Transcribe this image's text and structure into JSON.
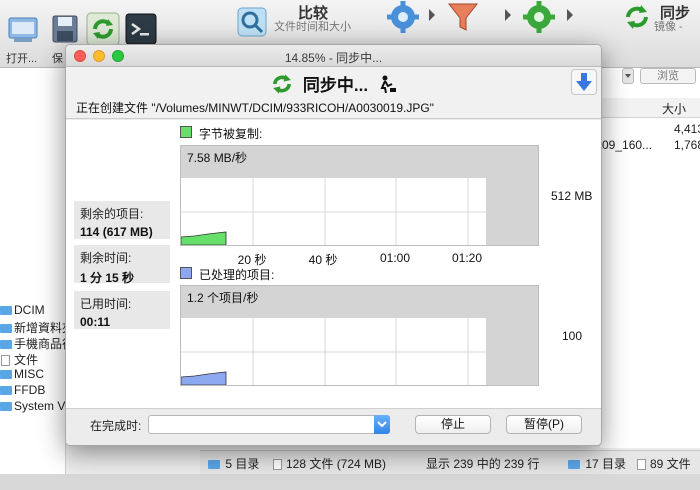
{
  "background": {
    "toolbar": {
      "open_label": "打开...",
      "save_label": "保",
      "compare_label": "比较",
      "compare_sub": "文件时间和大小",
      "sync_label": "同步",
      "sync_sub": "镜像 -"
    },
    "right_panel": {
      "browse_label": "浏览",
      "size_header": "大小",
      "size_1": "4,413",
      "name_2": "09_160...",
      "size_2": "1,768"
    },
    "tree": [
      {
        "label": "DCIM",
        "type": "folder"
      },
      {
        "label": "新增資料夾",
        "type": "folder"
      },
      {
        "label": "手機商品行",
        "type": "folder"
      },
      {
        "label": "文件",
        "type": "doc"
      },
      {
        "label": "MISC",
        "type": "folder"
      },
      {
        "label": "FFDB",
        "type": "folder"
      },
      {
        "label": "System V",
        "type": "folder"
      }
    ],
    "status": {
      "dirs_left": "5 目录",
      "files_left": "128 文件 (724 MB)",
      "shown": "显示 239 中的 239 行",
      "dirs_right": "17 目录",
      "files_right": "89 文件"
    }
  },
  "dialog": {
    "window_title": "14.85% - 同步中...",
    "heading": "同步中...",
    "creating_text": "正在创建文件 \"/Volumes/MINWT/DCIM/933RICOH/A0030019.JPG\"",
    "stats": {
      "remaining_items_label": "剩余的项目:",
      "remaining_items_value": "114 (617 MB)",
      "remaining_time_label": "剩余时间:",
      "remaining_time_value": "1 分 15 秒",
      "elapsed_time_label": "已用时间:",
      "elapsed_time_value": "00:11"
    },
    "on_complete_label": "在完成时:",
    "on_complete_value": "",
    "stop_label": "停止",
    "pause_label": "暂停(P)"
  },
  "colors": {
    "bytes_green": "#66e06a",
    "items_blue": "#8ca8f0",
    "accent_blue": "#2f84e9"
  },
  "chart_data": [
    {
      "type": "area",
      "legend": "字节被复制:",
      "rate": "7.58 MB/秒",
      "y_max_label": "512 MB",
      "x_ticks": [
        "20 秒",
        "40 秒",
        "01:00",
        "01:20"
      ],
      "progress_fraction": 0.1485
    },
    {
      "type": "area",
      "legend": "已处理的项目:",
      "rate": "1.2 个项目/秒",
      "y_max_label": "100",
      "progress_fraction": 0.1485
    }
  ]
}
